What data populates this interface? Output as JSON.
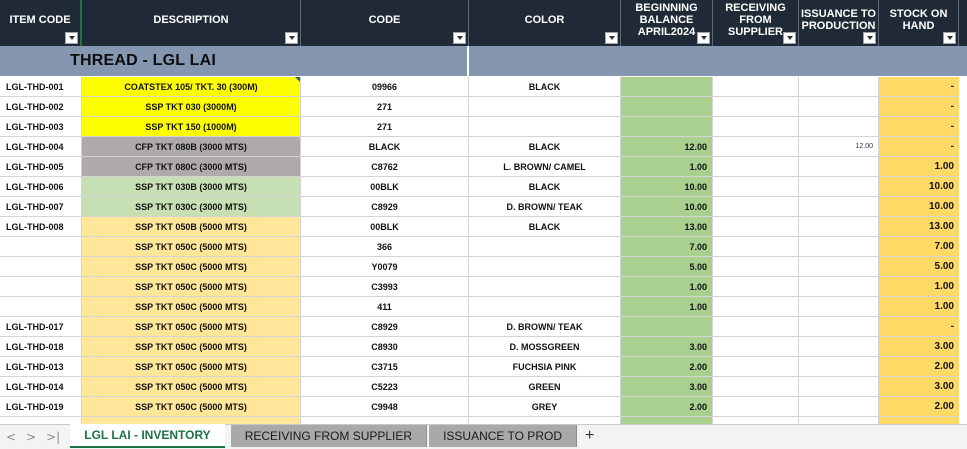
{
  "header": {
    "item_code": "ITEM CODE",
    "description": "DESCRIPTION",
    "code": "CODE",
    "color": "COLOR",
    "beginning": "BEGINNING BALANCE APRIL2024",
    "receiving": "RECEIVING FROM SUPPLIER",
    "issuance": "ISSUANCE TO PRODUCTION",
    "stock": "STOCK ON HAND"
  },
  "section_title": "THREAD - LGL LAI",
  "colors": {
    "header_bg": "#1f2a36",
    "title_bg": "#8496b0",
    "yellow": "#ffff00",
    "gray": "#aeaaaa",
    "light_green": "#c6e0b4",
    "light_orange": "#ffe699",
    "balance_green": "#a9d08e",
    "stock_orange": "#ffd966",
    "accent": "#1e7145"
  },
  "rows": [
    {
      "item": "LGL-THD-001",
      "desc": "COATSTEX 105/ TKT. 30 (300M)",
      "code": "09966",
      "color": "BLACK",
      "beg": "",
      "rec": "",
      "iss": "",
      "stock": "-",
      "fill": "yellow"
    },
    {
      "item": "LGL-THD-002",
      "desc": "SSP TKT 030 (3000M)",
      "code": "271",
      "color": "",
      "beg": "",
      "rec": "",
      "iss": "",
      "stock": "-",
      "fill": "yellow"
    },
    {
      "item": "LGL-THD-003",
      "desc": "SSP TKT 150 (1000M)",
      "code": "271",
      "color": "",
      "beg": "",
      "rec": "",
      "iss": "",
      "stock": "-",
      "fill": "yellow"
    },
    {
      "item": "LGL-THD-004",
      "desc": "CFP TKT 080B (3000 MTS)",
      "code": "BLACK",
      "color": "BLACK",
      "beg": "12.00",
      "rec": "",
      "iss": "12.00",
      "stock": "-",
      "fill": "gray"
    },
    {
      "item": "LGL-THD-005",
      "desc": "CFP TKT 080C (3000 MTS)",
      "code": "C8762",
      "color": "L. BROWN/ CAMEL",
      "beg": "1.00",
      "rec": "",
      "iss": "",
      "stock": "1.00",
      "fill": "gray"
    },
    {
      "item": "LGL-THD-006",
      "desc": "SSP TKT 030B (3000 MTS)",
      "code": "00BLK",
      "color": "BLACK",
      "beg": "10.00",
      "rec": "",
      "iss": "",
      "stock": "10.00",
      "fill": "light_green"
    },
    {
      "item": "LGL-THD-007",
      "desc": "SSP TKT 030C (3000 MTS)",
      "code": "C8929",
      "color": "D. BROWN/ TEAK",
      "beg": "10.00",
      "rec": "",
      "iss": "",
      "stock": "10.00",
      "fill": "light_green"
    },
    {
      "item": "LGL-THD-008",
      "desc": "SSP TKT 050B (5000 MTS)",
      "code": "00BLK",
      "color": "BLACK",
      "beg": "13.00",
      "rec": "",
      "iss": "",
      "stock": "13.00",
      "fill": "light_orange"
    },
    {
      "item": "",
      "desc": "SSP TKT 050C (5000 MTS)",
      "code": "366",
      "color": "",
      "beg": "7.00",
      "rec": "",
      "iss": "",
      "stock": "7.00",
      "fill": "light_orange"
    },
    {
      "item": "",
      "desc": "SSP TKT 050C (5000 MTS)",
      "code": "Y0079",
      "color": "",
      "beg": "5.00",
      "rec": "",
      "iss": "",
      "stock": "5.00",
      "fill": "light_orange"
    },
    {
      "item": "",
      "desc": "SSP TKT 050C (5000 MTS)",
      "code": "C3993",
      "color": "",
      "beg": "1.00",
      "rec": "",
      "iss": "",
      "stock": "1.00",
      "fill": "light_orange"
    },
    {
      "item": "",
      "desc": "SSP TKT 050C (5000 MTS)",
      "code": "411",
      "color": "",
      "beg": "1.00",
      "rec": "",
      "iss": "",
      "stock": "1.00",
      "fill": "light_orange"
    },
    {
      "item": "LGL-THD-017",
      "desc": "SSP TKT 050C (5000 MTS)",
      "code": "C8929",
      "color": "D. BROWN/ TEAK",
      "beg": "",
      "rec": "",
      "iss": "",
      "stock": "-",
      "fill": "light_orange"
    },
    {
      "item": "LGL-THD-018",
      "desc": "SSP TKT 050C (5000 MTS)",
      "code": "C8930",
      "color": "D. MOSSGREEN",
      "beg": "3.00",
      "rec": "",
      "iss": "",
      "stock": "3.00",
      "fill": "light_orange"
    },
    {
      "item": "LGL-THD-013",
      "desc": "SSP TKT 050C (5000 MTS)",
      "code": "C3715",
      "color": "FUCHSIA PINK",
      "beg": "2.00",
      "rec": "",
      "iss": "",
      "stock": "2.00",
      "fill": "light_orange"
    },
    {
      "item": "LGL-THD-014",
      "desc": "SSP TKT 050C (5000 MTS)",
      "code": "C5223",
      "color": "GREEN",
      "beg": "3.00",
      "rec": "",
      "iss": "",
      "stock": "3.00",
      "fill": "light_orange"
    },
    {
      "item": "LGL-THD-019",
      "desc": "SSP TKT 050C (5000 MTS)",
      "code": "C9948",
      "color": "GREY",
      "beg": "2.00",
      "rec": "",
      "iss": "",
      "stock": "2.00",
      "fill": "light_orange"
    },
    {
      "item": "",
      "desc": "",
      "code": "",
      "color": "",
      "beg": "",
      "rec": "",
      "iss": "",
      "stock": "",
      "fill": "light_orange"
    }
  ],
  "tabs": {
    "nav_first": "|<",
    "nav_prev": "<",
    "nav_next": ">",
    "nav_last": ">|",
    "active": "LGL LAI - INVENTORY",
    "tab2": "RECEIVING FROM SUPPLIER",
    "tab3": "ISSUANCE TO PROD",
    "add": "+"
  }
}
